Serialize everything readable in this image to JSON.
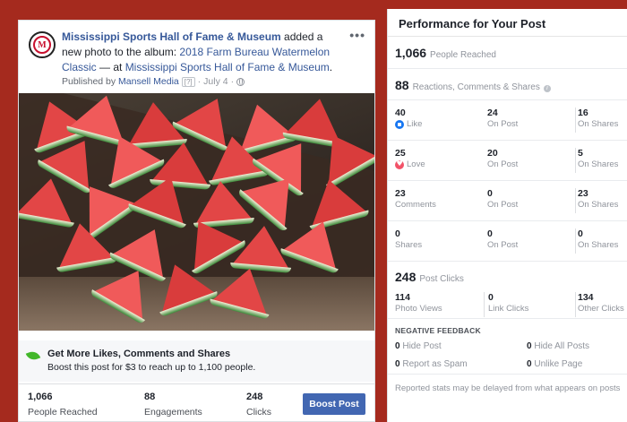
{
  "post": {
    "page_name": "Mississippi Sports Hall of Fame & Museum",
    "action_text": " added a new photo to the album: ",
    "album_name": "2018 Farm Bureau Watermelon Classic",
    "at_text": " — at ",
    "location": "Mississippi Sports Hall of Fame & Museum",
    "location_suffix": ".",
    "published_by": "Published by",
    "publisher": "Mansell Media",
    "help_badge": "[?]",
    "date": "July 4",
    "more_label": "•••"
  },
  "boost": {
    "title": "Get More Likes, Comments and Shares",
    "subtitle": "Boost this post for $3 to reach up to 1,100 people."
  },
  "footer": {
    "reached_value": "1,066",
    "reached_label": "People Reached",
    "engagements_value": "88",
    "engagements_label": "Engagements",
    "clicks_value": "248",
    "clicks_label": "Clicks",
    "boost_button": "Boost Post",
    "boost_button_color": "#4267b2"
  },
  "performance": {
    "title": "Performance for Your Post",
    "reached_value": "1,066",
    "reached_label": "People Reached",
    "engage_value": "88",
    "engage_label": "Reactions, Comments & Shares",
    "info_icon": "i",
    "rows": [
      {
        "icon": "like-icon",
        "v1": "40",
        "l1": "Like",
        "v2": "24",
        "l2": "On Post",
        "v3": "16",
        "l3": "On Shares"
      },
      {
        "icon": "love-icon",
        "v1": "25",
        "l1": "Love",
        "v2": "20",
        "l2": "On Post",
        "v3": "5",
        "l3": "On Shares"
      },
      {
        "icon": "",
        "v1": "23",
        "l1": "Comments",
        "v2": "0",
        "l2": "On Post",
        "v3": "23",
        "l3": "On Shares"
      },
      {
        "icon": "",
        "v1": "0",
        "l1": "Shares",
        "v2": "0",
        "l2": "On Post",
        "v3": "0",
        "l3": "On Shares"
      }
    ],
    "clicks_value": "248",
    "clicks_label": "Post Clicks",
    "clicks_breakdown": {
      "photo_views_value": "114",
      "photo_views_label": "Photo Views",
      "link_clicks_value": "0",
      "link_clicks_label": "Link Clicks",
      "other_clicks_value": "134",
      "other_clicks_label": "Other Clicks"
    },
    "negative_title": "NEGATIVE FEEDBACK",
    "negative": {
      "hide_post_value": "0",
      "hide_post_label": "Hide Post",
      "hide_all_value": "0",
      "hide_all_label": "Hide All Posts",
      "spam_value": "0",
      "spam_label": "Report as Spam",
      "unlike_value": "0",
      "unlike_label": "Unlike Page"
    },
    "disclaimer": "Reported stats may be delayed from what appears on posts"
  },
  "colors": {
    "background": "#a52a1e",
    "link": "#365899",
    "like": "#1877f2",
    "love": "#f25268",
    "boost_leaf": "#42b72a"
  }
}
